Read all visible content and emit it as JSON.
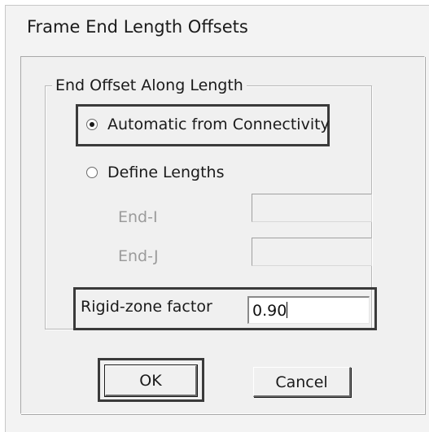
{
  "window": {
    "title": "Frame End Length Offsets"
  },
  "group": {
    "legend": "End Offset Along Length"
  },
  "options": {
    "automatic": {
      "label": "Automatic from Connectivity",
      "checked": true
    },
    "define": {
      "label": "Define Lengths",
      "checked": false
    }
  },
  "fields": {
    "end_i": {
      "label": "End-I",
      "value": ""
    },
    "end_j": {
      "label": "End-J",
      "value": ""
    },
    "rigid_zone": {
      "label": "Rigid-zone factor",
      "value": "0.90"
    }
  },
  "buttons": {
    "ok": "OK",
    "cancel": "Cancel"
  },
  "colors": {
    "dialog_bg": "#f3f3f3",
    "highlight_border": "#3a3a3a",
    "disabled_text": "#9b9b9b"
  }
}
